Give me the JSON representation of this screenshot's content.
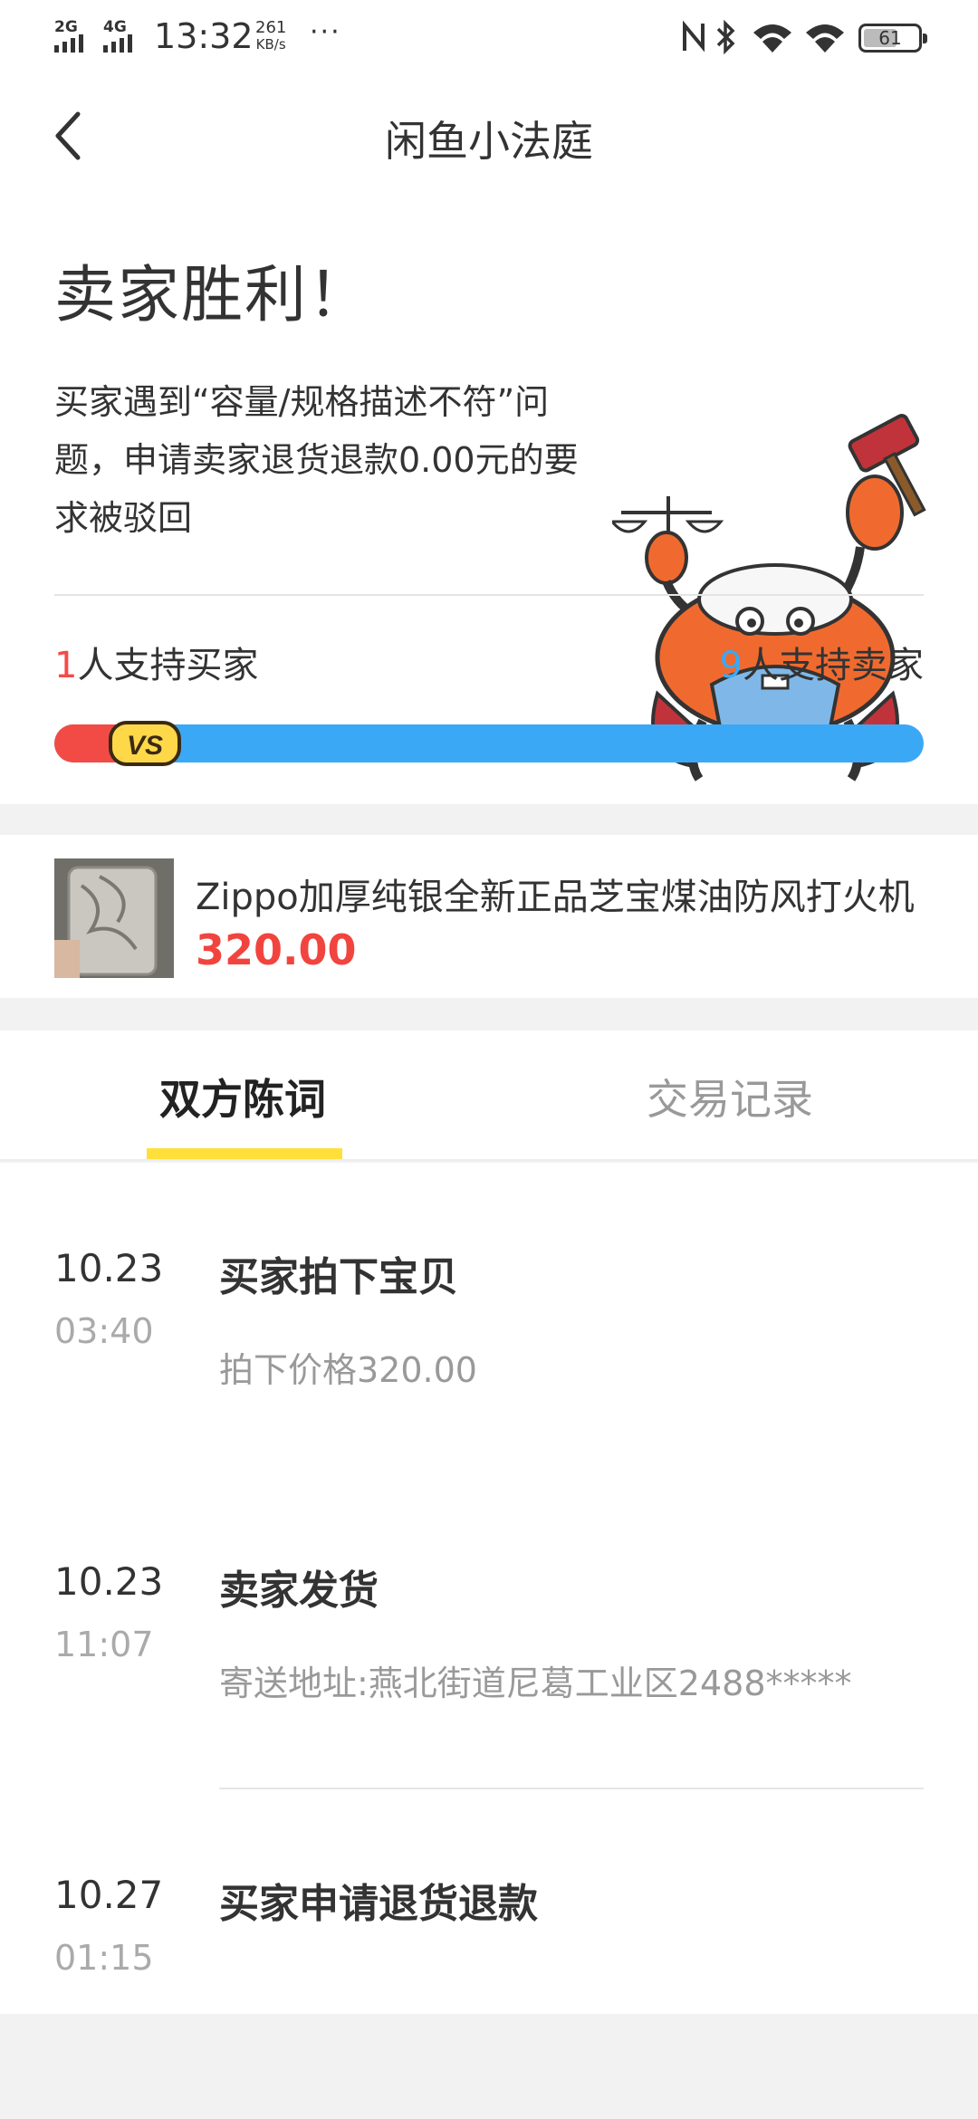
{
  "status_bar": {
    "net_1": "2G",
    "net_2": "4G",
    "time": "13:32",
    "speed_value": "261",
    "speed_unit": "KB/s",
    "more": "···",
    "battery": "61"
  },
  "header": {
    "title": "闲鱼小法庭"
  },
  "verdict": {
    "title": "卖家胜利！",
    "description": "买家遇到“容量/规格描述不符”问题，申请卖家退货退款0.00元的要求被驳回",
    "buyer_count": "1",
    "buyer_label": "人支持买家",
    "seller_count": "9",
    "seller_label": "人支持卖家",
    "vs_label": "VS",
    "buyer_share": 0.1
  },
  "product": {
    "title": "Zippo加厚纯银全新正品芝宝煤油防风打火机",
    "price": "320.00"
  },
  "tabs": [
    {
      "label": "双方陈词",
      "active": true
    },
    {
      "label": "交易记录",
      "active": false
    }
  ],
  "timeline": [
    {
      "date": "10.23",
      "time": "03:40",
      "event": "买家拍下宝贝",
      "detail": "拍下价格320.00"
    },
    {
      "date": "10.23",
      "time": "11:07",
      "event": "卖家发货",
      "detail": "寄送地址:燕北街道尼葛工业区2488*****"
    },
    {
      "date": "10.27",
      "time": "01:15",
      "event": "买家申请退货退款",
      "detail": ""
    }
  ],
  "colors": {
    "buyer": "#f24b45",
    "seller": "#3ba8f5",
    "tab_indicator": "#ffe03a",
    "price": "#f2443e"
  }
}
